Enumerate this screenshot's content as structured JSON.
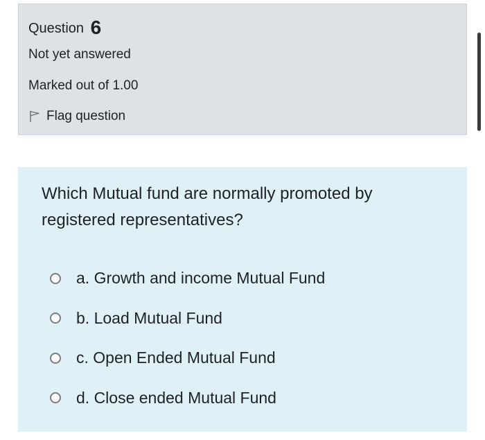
{
  "question_info": {
    "label": "Question",
    "number": "6",
    "state": "Not yet answered",
    "grade": "Marked out of 1.00",
    "flag_label": "Flag question",
    "flag_icon": "flag-outline-icon"
  },
  "question": {
    "text": "Which Mutual fund are normally promoted by registered representatives?",
    "options": [
      {
        "letter": "a.",
        "label": "a. Growth and income Mutual Fund",
        "selected": false
      },
      {
        "letter": "b.",
        "label": "b. Load Mutual Fund",
        "selected": false
      },
      {
        "letter": "c.",
        "label": "c. Open Ended Mutual Fund",
        "selected": false
      },
      {
        "letter": "d.",
        "label": "d. Close ended Mutual Fund",
        "selected": false
      }
    ]
  },
  "colors": {
    "info_background": "#dee2e6",
    "content_background": "#dff1f7",
    "text": "#1d2125",
    "radio_border": "#7d7d7d",
    "scrollbar": "#3a3a3a"
  }
}
